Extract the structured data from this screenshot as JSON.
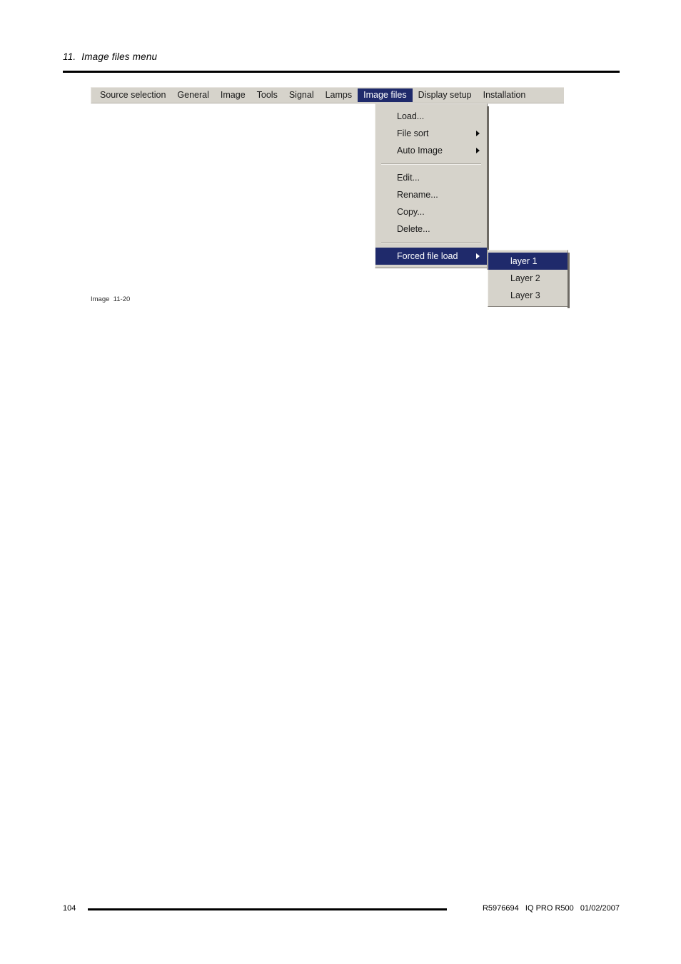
{
  "page": {
    "chapter_title": "11.  Image files menu",
    "figure_caption": "Image  11-20",
    "footer": {
      "page_number": "104",
      "meta": "R5976694   IQ PRO R500   01/02/2007"
    }
  },
  "colors": {
    "menu_face": "#d6d3cb",
    "highlight": "#1f2a6b",
    "highlight_text": "#ffffff",
    "text": "#1a1a1a"
  },
  "menubar": {
    "items": [
      {
        "label": "Source selection",
        "active": false
      },
      {
        "label": "General",
        "active": false
      },
      {
        "label": "Image",
        "active": false
      },
      {
        "label": "Tools",
        "active": false
      },
      {
        "label": "Signal",
        "active": false
      },
      {
        "label": "Lamps",
        "active": false
      },
      {
        "label": "Image files",
        "active": true
      },
      {
        "label": "Display setup",
        "active": false
      },
      {
        "label": "Installation",
        "active": false
      }
    ]
  },
  "dropdown": {
    "owner": "Image files",
    "rows": [
      {
        "label": "Load...",
        "submenu": false,
        "highlight": false
      },
      {
        "label": "File sort",
        "submenu": true,
        "highlight": false
      },
      {
        "label": "Auto Image",
        "submenu": true,
        "highlight": false
      },
      {
        "label": "Edit...",
        "submenu": false,
        "highlight": false
      },
      {
        "label": "Rename...",
        "submenu": false,
        "highlight": false
      },
      {
        "label": "Copy...",
        "submenu": false,
        "highlight": false
      },
      {
        "label": "Delete...",
        "submenu": false,
        "highlight": false
      },
      {
        "label": "Forced file load",
        "submenu": true,
        "highlight": true
      }
    ]
  },
  "submenu": {
    "owner": "Forced file load",
    "rows": [
      {
        "label": "layer 1",
        "highlight": true
      },
      {
        "label": "Layer 2",
        "highlight": false
      },
      {
        "label": "Layer 3",
        "highlight": false
      }
    ]
  }
}
